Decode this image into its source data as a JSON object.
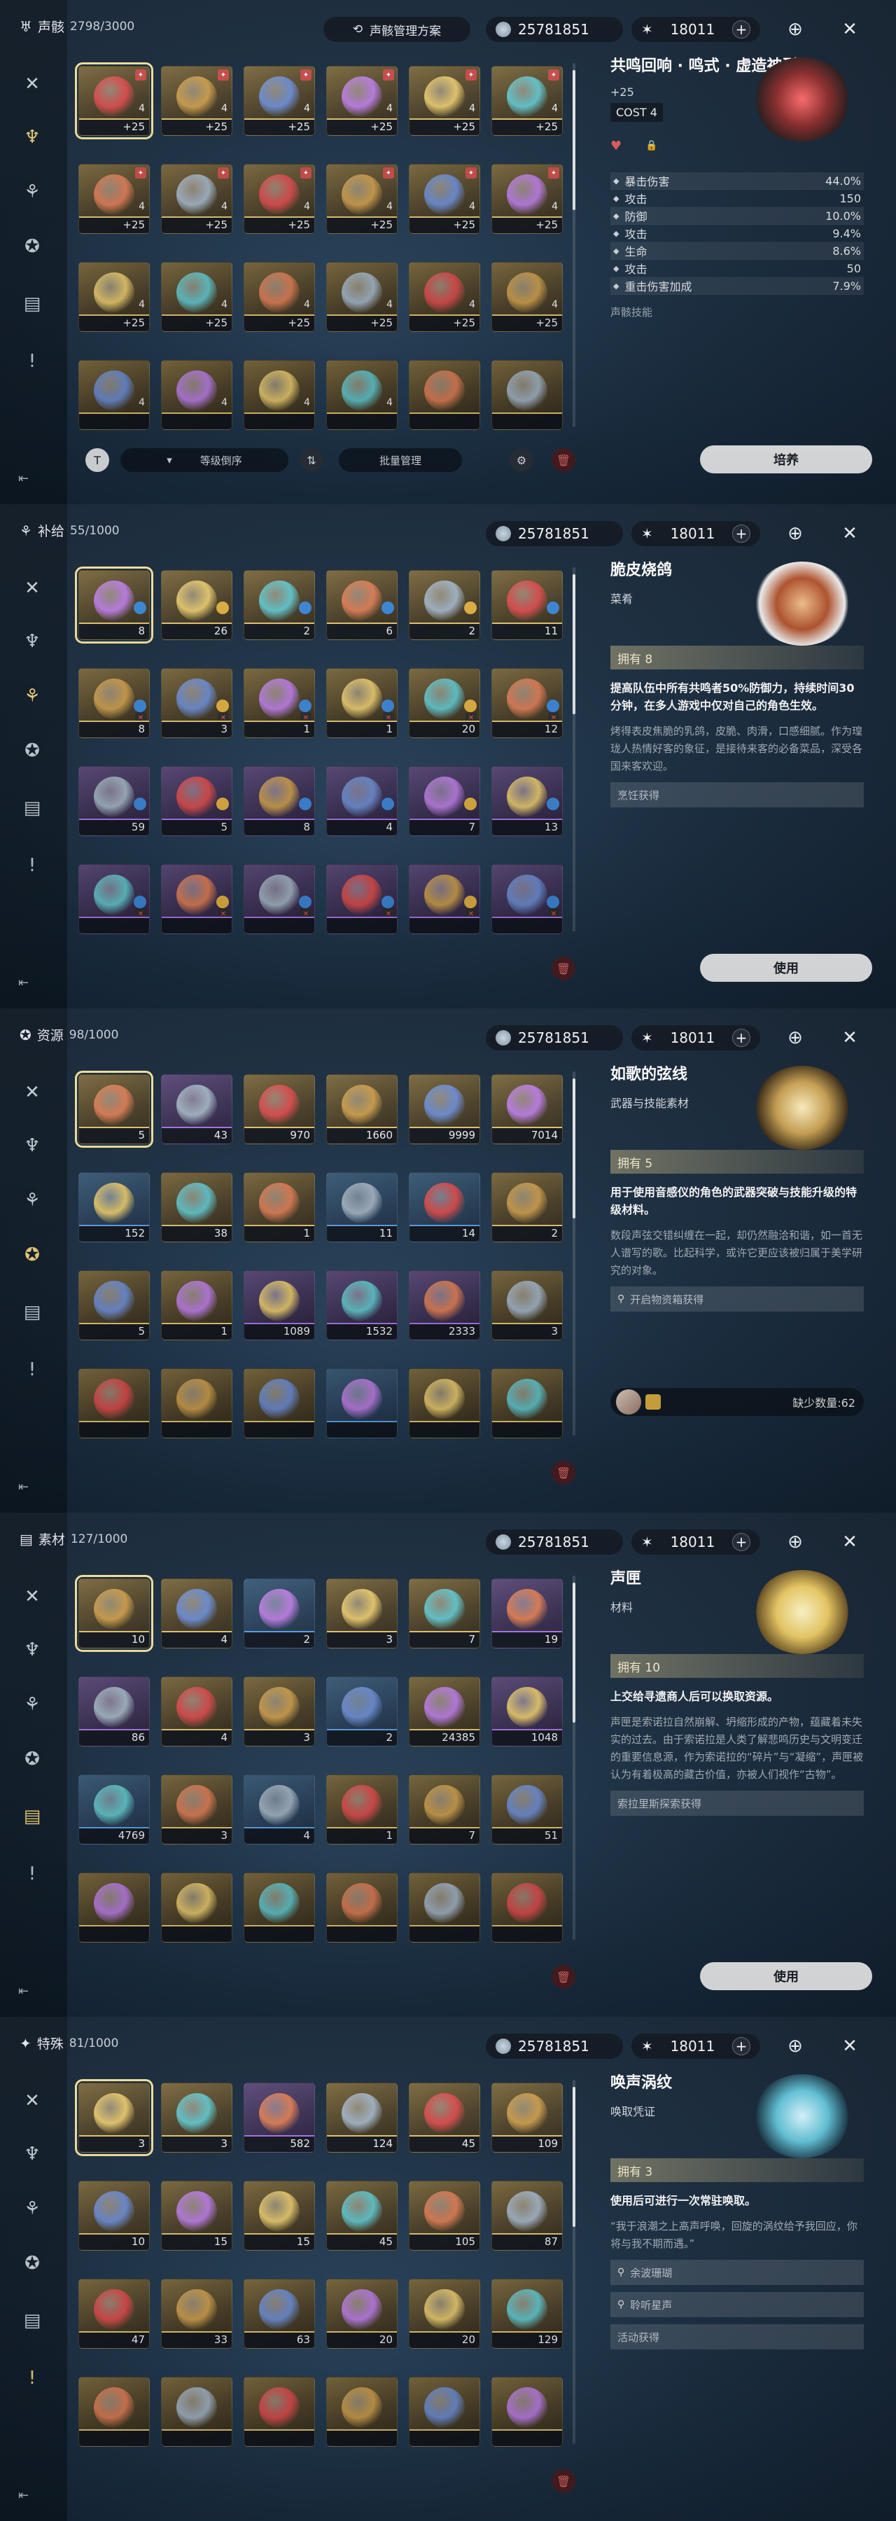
{
  "colors": {
    "accent": "#f2e09a",
    "gold": "#e2c671",
    "purple": "#a874e6",
    "danger": "#c94a4a"
  },
  "rail_icons": [
    "sword-icon",
    "echo-icon",
    "food-icon",
    "resource-icon",
    "material-icon",
    "special-icon"
  ],
  "panels": [
    {
      "id": "echo",
      "header": {
        "icon": "echo-icon",
        "title": "声骸",
        "count": "2798/3000"
      },
      "scheme_label": "声骸管理方案",
      "currency": "25781851",
      "energy": "18011",
      "rows": [
        [
          {
            "v": "+25",
            "tone": "gold",
            "l": "4",
            "sel": true
          },
          {
            "v": "+25",
            "tone": "gold",
            "l": "4"
          },
          {
            "v": "+25",
            "tone": "gold",
            "l": "4"
          },
          {
            "v": "+25",
            "tone": "gold",
            "l": "4"
          },
          {
            "v": "+25",
            "tone": "gold",
            "l": "4"
          },
          {
            "v": "+25",
            "tone": "gold",
            "l": "4"
          }
        ],
        [
          {
            "v": "+25",
            "tone": "gold",
            "l": "4"
          },
          {
            "v": "+25",
            "tone": "gold",
            "l": "4"
          },
          {
            "v": "+25",
            "tone": "gold",
            "l": "4"
          },
          {
            "v": "+25",
            "tone": "gold",
            "l": "4"
          },
          {
            "v": "+25",
            "tone": "gold",
            "l": "4"
          },
          {
            "v": "+25",
            "tone": "gold",
            "l": "4"
          }
        ],
        [
          {
            "v": "+25",
            "tone": "gold",
            "l": "4"
          },
          {
            "v": "+25",
            "tone": "gold",
            "l": "4"
          },
          {
            "v": "+25",
            "tone": "gold",
            "l": "4"
          },
          {
            "v": "+25",
            "tone": "gold",
            "l": "4"
          },
          {
            "v": "+25",
            "tone": "gold",
            "l": "4"
          },
          {
            "v": "+25",
            "tone": "gold",
            "l": "4"
          }
        ],
        [
          {
            "v": "",
            "tone": "gold",
            "l": "4"
          },
          {
            "v": "",
            "tone": "gold",
            "l": "4"
          },
          {
            "v": "",
            "tone": "gold",
            "l": "4"
          },
          {
            "v": "",
            "tone": "gold",
            "l": "4"
          },
          {
            "v": "",
            "tone": "gold",
            "l": ""
          },
          {
            "v": "",
            "tone": "gold",
            "l": ""
          }
        ]
      ],
      "detail": {
        "name": "共鸣回响 · 鸣式 · 虚造神型",
        "level": "+25",
        "cost": "COST 4",
        "stats": [
          {
            "label": "暴击伤害",
            "value": "44.0%"
          },
          {
            "label": "攻击",
            "value": "150"
          },
          {
            "label": "防御",
            "value": "10.0%"
          },
          {
            "label": "攻击",
            "value": "9.4%"
          },
          {
            "label": "生命",
            "value": "8.6%"
          },
          {
            "label": "攻击",
            "value": "50"
          },
          {
            "label": "重击伤害加成",
            "value": "7.9%"
          }
        ],
        "skill_label": "声骸技能"
      },
      "sort_label": "等级倒序",
      "batch_label": "批量管理",
      "action_label": "培养"
    },
    {
      "id": "supply",
      "header": {
        "icon": "food-icon",
        "title": "补给",
        "count": "55/1000"
      },
      "currency": "25781851",
      "energy": "18011",
      "rows": [
        [
          {
            "v": "8",
            "tone": "gold",
            "sel": true
          },
          {
            "v": "26",
            "tone": "gold"
          },
          {
            "v": "2",
            "tone": "gold"
          },
          {
            "v": "6",
            "tone": "gold"
          },
          {
            "v": "2",
            "tone": "gold"
          },
          {
            "v": "11",
            "tone": "gold"
          }
        ],
        [
          {
            "v": "8",
            "tone": "gold"
          },
          {
            "v": "3",
            "tone": "gold"
          },
          {
            "v": "1",
            "tone": "gold"
          },
          {
            "v": "1",
            "tone": "gold"
          },
          {
            "v": "20",
            "tone": "gold"
          },
          {
            "v": "12",
            "tone": "gold"
          }
        ],
        [
          {
            "v": "59",
            "tone": "purple"
          },
          {
            "v": "5",
            "tone": "purple"
          },
          {
            "v": "8",
            "tone": "purple"
          },
          {
            "v": "4",
            "tone": "purple"
          },
          {
            "v": "7",
            "tone": "purple"
          },
          {
            "v": "13",
            "tone": "purple"
          }
        ],
        [
          {
            "v": "",
            "tone": "purple"
          },
          {
            "v": "",
            "tone": "purple"
          },
          {
            "v": "",
            "tone": "purple"
          },
          {
            "v": "",
            "tone": "purple"
          },
          {
            "v": "",
            "tone": "purple"
          },
          {
            "v": "",
            "tone": "purple"
          }
        ]
      ],
      "detail": {
        "name": "脆皮烧鸽",
        "sub": "菜肴",
        "owned": "拥有 8",
        "effect": "提高队伍中所有共鸣者50%防御力，持续时间30分钟，在多人游戏中仅对自己的角色生效。",
        "desc": "烤得表皮焦脆的乳鸽，皮脆、肉滑，口感细腻。作为瑝珑人热情好客的象征，是接待来客的必备菜品，深受各国来客欢迎。",
        "source": "烹饪获得"
      },
      "action_label": "使用"
    },
    {
      "id": "resource",
      "header": {
        "icon": "resource-icon",
        "title": "资源",
        "count": "98/1000"
      },
      "currency": "25781851",
      "energy": "18011",
      "rows": [
        [
          {
            "v": "5",
            "tone": "gold",
            "sel": true
          },
          {
            "v": "43",
            "tone": "purple"
          },
          {
            "v": "970",
            "tone": "gold"
          },
          {
            "v": "1660",
            "tone": "gold"
          },
          {
            "v": "9999",
            "tone": "gold"
          },
          {
            "v": "7014",
            "tone": "gold"
          }
        ],
        [
          {
            "v": "152",
            "tone": "blue"
          },
          {
            "v": "38",
            "tone": "gold"
          },
          {
            "v": "1",
            "tone": "gold"
          },
          {
            "v": "11",
            "tone": "blue"
          },
          {
            "v": "14",
            "tone": "blue"
          },
          {
            "v": "2",
            "tone": "gold"
          }
        ],
        [
          {
            "v": "5",
            "tone": "gold"
          },
          {
            "v": "1",
            "tone": "gold"
          },
          {
            "v": "1089",
            "tone": "purple"
          },
          {
            "v": "1532",
            "tone": "purple"
          },
          {
            "v": "2333",
            "tone": "purple"
          },
          {
            "v": "3",
            "tone": "gold"
          }
        ],
        [
          {
            "v": "",
            "tone": "gold"
          },
          {
            "v": "",
            "tone": "gold"
          },
          {
            "v": "",
            "tone": "gold"
          },
          {
            "v": "",
            "tone": "blue"
          },
          {
            "v": "",
            "tone": "gold"
          },
          {
            "v": "",
            "tone": "gold"
          }
        ]
      ],
      "detail": {
        "name": "如歌的弦线",
        "sub": "武器与技能素材",
        "owned": "拥有 5",
        "effect": "用于使用音感仪的角色的武器突破与技能升级的特级材料。",
        "desc": "数段声弦交错纠缠在一起，却仍然融洽和谐，如一首无人谱写的歌。比起科学，或许它更应该被归属于美学研究的对象。",
        "source": "开启物资箱获得",
        "shortage": "缺少数量:62"
      }
    },
    {
      "id": "material",
      "header": {
        "icon": "material-icon",
        "title": "素材",
        "count": "127/1000"
      },
      "currency": "25781851",
      "energy": "18011",
      "rows": [
        [
          {
            "v": "10",
            "tone": "gold",
            "sel": true
          },
          {
            "v": "4",
            "tone": "gold"
          },
          {
            "v": "2",
            "tone": "blue"
          },
          {
            "v": "3",
            "tone": "gold"
          },
          {
            "v": "7",
            "tone": "gold"
          },
          {
            "v": "19",
            "tone": "purple"
          }
        ],
        [
          {
            "v": "86",
            "tone": "purple"
          },
          {
            "v": "4",
            "tone": "gold"
          },
          {
            "v": "3",
            "tone": "gold"
          },
          {
            "v": "2",
            "tone": "blue"
          },
          {
            "v": "24385",
            "tone": "gold"
          },
          {
            "v": "1048",
            "tone": "purple"
          }
        ],
        [
          {
            "v": "4769",
            "tone": "blue"
          },
          {
            "v": "3",
            "tone": "gold"
          },
          {
            "v": "4",
            "tone": "blue"
          },
          {
            "v": "1",
            "tone": "gold"
          },
          {
            "v": "7",
            "tone": "gold"
          },
          {
            "v": "51",
            "tone": "gold"
          }
        ],
        [
          {
            "v": "",
            "tone": "gold"
          },
          {
            "v": "",
            "tone": "gold"
          },
          {
            "v": "",
            "tone": "gold"
          },
          {
            "v": "",
            "tone": "gold"
          },
          {
            "v": "",
            "tone": "gold"
          },
          {
            "v": "",
            "tone": "gold"
          }
        ]
      ],
      "detail": {
        "name": "声匣",
        "sub": "材料",
        "owned": "拥有 10",
        "effect": "上交给寻遗商人后可以换取资源。",
        "desc": "声匣是索诺拉自然崩解、坍缩形成的产物，蕴藏着未失实的过去。由于索诺拉是人类了解悲鸣历史与文明变迁的重要信息源，作为索诺拉的“碎片”与“凝缩”，声匣被认为有着极高的藏古价值，亦被人们视作“古物”。",
        "source": "索拉里斯探索获得"
      },
      "action_label": "使用"
    },
    {
      "id": "special",
      "header": {
        "icon": "special-icon",
        "title": "特殊",
        "count": "81/1000"
      },
      "currency": "25781851",
      "energy": "18011",
      "rows": [
        [
          {
            "v": "3",
            "tone": "gold",
            "sel": true
          },
          {
            "v": "3",
            "tone": "gold"
          },
          {
            "v": "582",
            "tone": "purple"
          },
          {
            "v": "124",
            "tone": "gold"
          },
          {
            "v": "45",
            "tone": "gold"
          },
          {
            "v": "109",
            "tone": "gold"
          }
        ],
        [
          {
            "v": "10",
            "tone": "gold"
          },
          {
            "v": "15",
            "tone": "gold"
          },
          {
            "v": "15",
            "tone": "gold"
          },
          {
            "v": "45",
            "tone": "gold"
          },
          {
            "v": "105",
            "tone": "gold"
          },
          {
            "v": "87",
            "tone": "gold"
          }
        ],
        [
          {
            "v": "47",
            "tone": "gold"
          },
          {
            "v": "33",
            "tone": "gold"
          },
          {
            "v": "63",
            "tone": "gold"
          },
          {
            "v": "20",
            "tone": "gold"
          },
          {
            "v": "20",
            "tone": "gold"
          },
          {
            "v": "129",
            "tone": "gold"
          }
        ],
        [
          {
            "v": "",
            "tone": "gold"
          },
          {
            "v": "",
            "tone": "gold"
          },
          {
            "v": "",
            "tone": "gold"
          },
          {
            "v": "",
            "tone": "gold"
          },
          {
            "v": "",
            "tone": "gold"
          },
          {
            "v": "",
            "tone": "gold"
          }
        ]
      ],
      "detail": {
        "name": "唤声涡纹",
        "sub": "唤取凭证",
        "owned": "拥有 3",
        "effect": "使用后可进行一次常驻唤取。",
        "desc": "“我于浪潮之上高声呼唤，回旋的涡纹给予我回应，你将与我不期而遇。”",
        "sources": [
          "余波珊瑚",
          "聆听星声",
          "活动获得"
        ]
      }
    }
  ]
}
